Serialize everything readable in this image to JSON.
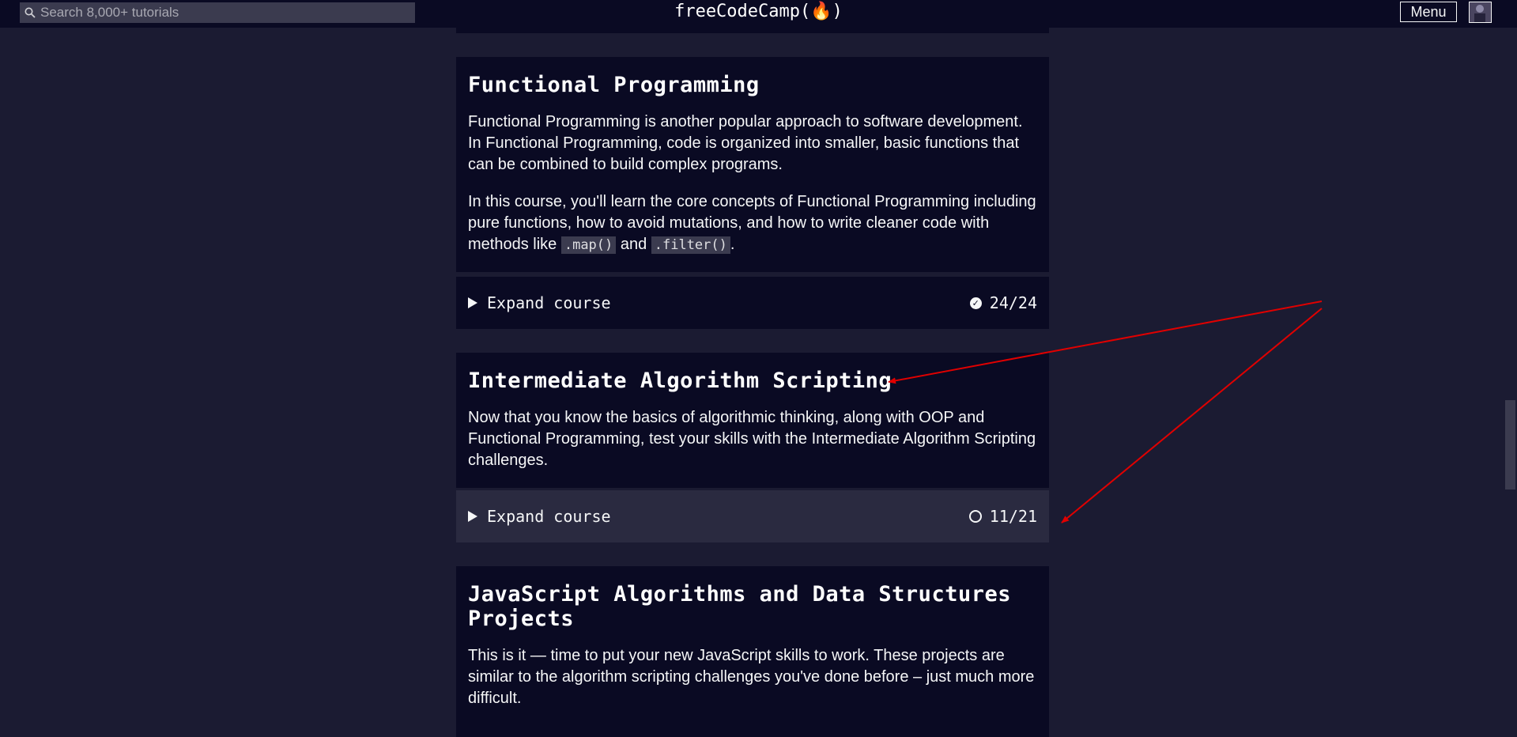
{
  "navbar": {
    "search_placeholder": "Search 8,000+ tutorials",
    "logo_text": "freeCodeCamp(🔥)",
    "menu_label": "Menu"
  },
  "cards": [
    {
      "title": "Functional Programming",
      "paragraph1": "Functional Programming is another popular approach to software development. In Functional Programming, code is organized into smaller, basic functions that can be combined to build complex programs.",
      "paragraph2_before": "In this course, you'll learn the core concepts of Functional Programming including pure functions, how to avoid mutations, and how to write cleaner code with methods like ",
      "code1": ".map()",
      "paragraph2_mid": " and ",
      "code2": ".filter()",
      "paragraph2_after": ".",
      "expand_label": "Expand course",
      "progress": "24/24",
      "completed": true
    },
    {
      "title": "Intermediate Algorithm Scripting",
      "paragraph1": "Now that you know the basics of algorithmic thinking, along with OOP and Functional Programming, test your skills with the Intermediate Algorithm Scripting challenges.",
      "expand_label": "Expand course",
      "progress": "11/21",
      "completed": false
    },
    {
      "title": "JavaScript Algorithms and Data Structures Projects",
      "paragraph1": "This is it — time to put your new JavaScript skills to work. These projects are similar to the algorithm scripting challenges you've done before – just much more difficult."
    }
  ],
  "colors": {
    "background": "#1b1b32",
    "card": "#0a0a23",
    "annotation": "#e00000"
  }
}
